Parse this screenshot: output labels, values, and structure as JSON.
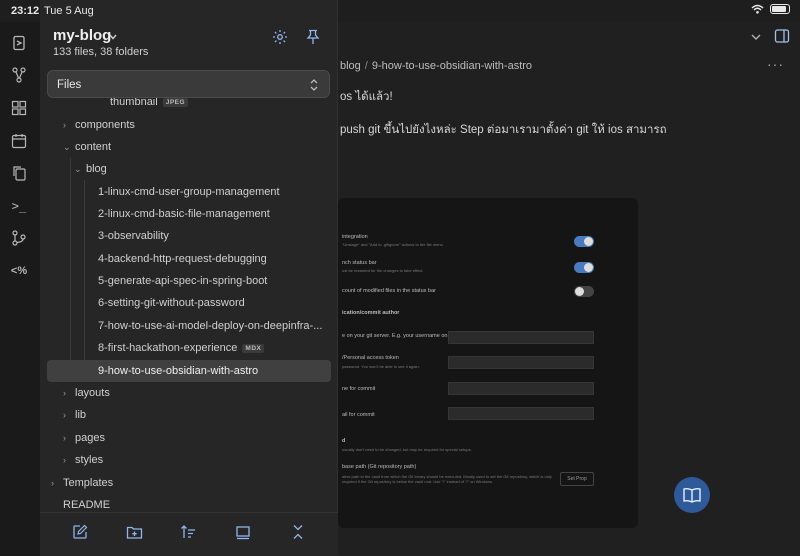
{
  "status_bar": {
    "time": "23:12",
    "date": "Tue 5 Aug"
  },
  "ribbon": {
    "icons": [
      "open-vault-icon",
      "graph-icon",
      "blocks-icon",
      "calendar-icon",
      "copy-icon",
      "terminal-icon",
      "git-icon",
      "regex-icon"
    ],
    "regex_glyph": "<%",
    "terminal_glyph": ">_"
  },
  "explorer": {
    "vault_name": "my-blog",
    "summary": "133 files, 38 folders",
    "view_selector": "Files",
    "tree": [
      {
        "label": "thumbnail",
        "badge": "JPEG",
        "depth": 3,
        "expanded": null,
        "selected": false
      },
      {
        "label": "components",
        "depth": 1,
        "expanded": false,
        "selected": false
      },
      {
        "label": "content",
        "depth": 1,
        "expanded": true,
        "selected": false
      },
      {
        "label": "blog",
        "depth": 2,
        "expanded": true,
        "selected": false
      },
      {
        "label": "1-linux-cmd-user-group-management",
        "depth": 3,
        "selected": false
      },
      {
        "label": "2-linux-cmd-basic-file-management",
        "depth": 3,
        "selected": false
      },
      {
        "label": "3-observability",
        "depth": 3,
        "selected": false
      },
      {
        "label": "4-backend-http-request-debugging",
        "depth": 3,
        "selected": false
      },
      {
        "label": "5-generate-api-spec-in-spring-boot",
        "depth": 3,
        "selected": false
      },
      {
        "label": "6-setting-git-without-password",
        "depth": 3,
        "selected": false
      },
      {
        "label": "7-how-to-use-ai-model-deploy-on-deepinfra-...",
        "depth": 3,
        "selected": false
      },
      {
        "label": "8-first-hackathon-experience",
        "badge": "MDX",
        "depth": 3,
        "selected": false
      },
      {
        "label": "9-how-to-use-obsidian-with-astro",
        "depth": 3,
        "selected": true
      },
      {
        "label": "layouts",
        "depth": 1,
        "expanded": false,
        "selected": false
      },
      {
        "label": "lib",
        "depth": 1,
        "expanded": false,
        "selected": false
      },
      {
        "label": "pages",
        "depth": 1,
        "expanded": false,
        "selected": false
      },
      {
        "label": "styles",
        "depth": 1,
        "expanded": false,
        "selected": false
      },
      {
        "label": "Templates",
        "depth": 0,
        "expanded": false,
        "selected": false
      },
      {
        "label": "README",
        "depth": 0,
        "expanded": null,
        "selected": false
      }
    ],
    "toolbar": [
      "new-note-icon",
      "new-folder-icon",
      "sort-icon",
      "collapse-view-icon",
      "collapse-all-icon"
    ]
  },
  "editor": {
    "breadcrumb": [
      "blog",
      "9-how-to-use-obsidian-with-astro"
    ],
    "lines": [
      "os ได้แล้ว!",
      "push git ขึ้นไปยังไงหล่ะ Step ต่อมาเรามาตั้งค่า git ให้ ios สามารถ"
    ],
    "image": {
      "rows": [
        {
          "title": "integration",
          "sub": "\"Unstage\" and \"Add to .gitignore\" actions to the file menu",
          "toggle": true
        },
        {
          "title": "nch status bar",
          "sub": "ust be restarted for the changes to take effect.",
          "toggle": true
        },
        {
          "title": "count of modified files in the status bar",
          "sub": "",
          "toggle": false
        },
        {
          "title": "ication/commit author",
          "sub": "",
          "toggle": null
        },
        {
          "title": "e on your git server. E.g. your username on GitHub",
          "sub": "",
          "field": true
        },
        {
          "title": "/Personal access token",
          "sub": "password. You won't be able to see it again.",
          "field": true
        },
        {
          "title": "ne for commit",
          "sub": "",
          "field": true
        },
        {
          "title": "ail for commit",
          "sub": "",
          "field": true
        },
        {
          "title": "d",
          "sub": "usually don't need to be changed, but may be required for special setups.",
          "toggle": null
        },
        {
          "title": "base path (Git repository path)",
          "sub": "ative path to the vault from which the Git binary should be executed. Mostly used to set the Git repository, which is only required if the Git repository is below the vault root. Use \"\\\" instead of \"/\" on Windows.",
          "toggle": null
        }
      ],
      "button_label": "Set Prop"
    },
    "fab_icon": "reading-view-icon"
  },
  "colors": {
    "accent": "#4a7bbf",
    "fab": "#2e5a9a",
    "panel": "#262626",
    "selected": "#404040"
  }
}
